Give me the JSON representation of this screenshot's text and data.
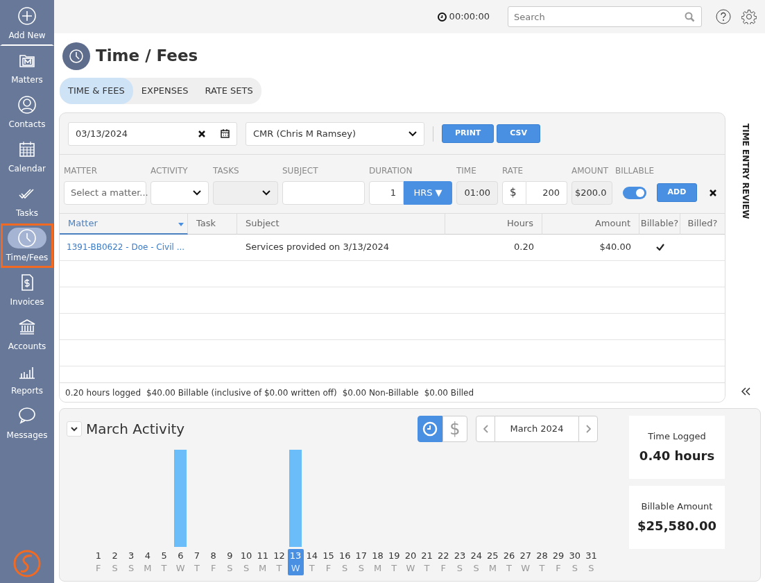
{
  "sidebar": {
    "items": [
      {
        "label": "Add New",
        "kind": "add",
        "selected": false
      },
      {
        "label": "Matters",
        "kind": "matters",
        "selected": false
      },
      {
        "label": "Contacts",
        "kind": "contacts",
        "selected": false
      },
      {
        "label": "Calendar",
        "kind": "calendar",
        "selected": false
      },
      {
        "label": "Tasks",
        "kind": "tasks",
        "selected": false
      },
      {
        "label": "Time/Fees",
        "kind": "time",
        "selected": true
      },
      {
        "label": "Invoices",
        "kind": "invoices",
        "selected": false
      },
      {
        "label": "Accounts",
        "kind": "accounts",
        "selected": false
      },
      {
        "label": "Reports",
        "kind": "reports",
        "selected": false
      },
      {
        "label": "Messages",
        "kind": "messages",
        "selected": false
      }
    ]
  },
  "header": {
    "timer": "00:00:00",
    "search": {
      "placeholder": "Search"
    }
  },
  "page": {
    "title": "Time / Fees"
  },
  "tabs": [
    {
      "label": "TIME & FEES",
      "selected": true
    },
    {
      "label": "EXPENSES",
      "selected": false
    },
    {
      "label": "RATE SETS",
      "selected": false
    }
  ],
  "toolbar": {
    "date": "03/13/2024",
    "user": "CMR (Chris M Ramsey)",
    "buttons": [
      "PRINT",
      "CSV"
    ]
  },
  "entry_form": {
    "matter": {
      "label": "MATTER",
      "placeholder": "Select a matter..."
    },
    "activity": {
      "label": "ACTIVITY",
      "disabled": false
    },
    "tasks": {
      "label": "TASKS",
      "disabled": true
    },
    "subject": {
      "label": "SUBJECT"
    },
    "duration": {
      "label": "DURATION",
      "value": "1",
      "unit": "HRS ▼"
    },
    "time": {
      "label": "TIME",
      "value": "01:00"
    },
    "rate": {
      "label": "RATE",
      "prefix": "$",
      "value": "200"
    },
    "amount": {
      "label": "AMOUNT",
      "value": "$200.0"
    },
    "billable": {
      "label": "BILLABLE",
      "on": true
    },
    "add_button": "ADD"
  },
  "table": {
    "columns": [
      {
        "label": "Matter",
        "sorted": true
      },
      {
        "label": "Task",
        "sorted": false
      },
      {
        "label": "Subject",
        "sorted": false
      },
      {
        "label": "Hours",
        "sorted": false
      },
      {
        "label": "Amount",
        "sorted": false
      },
      {
        "label": "Billable?",
        "sorted": false
      },
      {
        "label": "Billed?",
        "sorted": false
      }
    ],
    "rows": [
      {
        "matter": "1391-BB0622 - Doe - Civil ...",
        "subject": "Services provided on 3/13/2024",
        "hours": "0.20",
        "amount": "$40.00",
        "billable": true
      }
    ]
  },
  "summary": [
    "0.20 hours logged",
    "$40.00 Billable (inclusive of $0.00 written off)",
    "$0.00 Non-Billable",
    "$0.00 Billed"
  ],
  "side_panel": {
    "title": "TIME ENTRY REVIEW"
  },
  "activity": {
    "title": "March Activity",
    "modes": [
      {
        "kind": "time",
        "selected": true
      },
      {
        "kind": "money",
        "label": "$",
        "selected": false
      }
    ],
    "month": "March 2024",
    "days": [
      {
        "day": "1",
        "weekday": "F",
        "has_bar": false,
        "selected": false
      },
      {
        "day": "2",
        "weekday": "S",
        "has_bar": false,
        "selected": false
      },
      {
        "day": "3",
        "weekday": "S",
        "has_bar": false,
        "selected": false
      },
      {
        "day": "4",
        "weekday": "M",
        "has_bar": false,
        "selected": false
      },
      {
        "day": "5",
        "weekday": "T",
        "has_bar": false,
        "selected": false
      },
      {
        "day": "6",
        "weekday": "W",
        "has_bar": true,
        "selected": false
      },
      {
        "day": "7",
        "weekday": "T",
        "has_bar": false,
        "selected": false
      },
      {
        "day": "8",
        "weekday": "F",
        "has_bar": false,
        "selected": false
      },
      {
        "day": "9",
        "weekday": "S",
        "has_bar": false,
        "selected": false
      },
      {
        "day": "10",
        "weekday": "S",
        "has_bar": false,
        "selected": false
      },
      {
        "day": "11",
        "weekday": "M",
        "has_bar": false,
        "selected": false
      },
      {
        "day": "12",
        "weekday": "T",
        "has_bar": false,
        "selected": false
      },
      {
        "day": "13",
        "weekday": "W",
        "has_bar": true,
        "selected": true
      },
      {
        "day": "14",
        "weekday": "T",
        "has_bar": false,
        "selected": false
      },
      {
        "day": "15",
        "weekday": "F",
        "has_bar": false,
        "selected": false
      },
      {
        "day": "16",
        "weekday": "S",
        "has_bar": false,
        "selected": false
      },
      {
        "day": "17",
        "weekday": "S",
        "has_bar": false,
        "selected": false
      },
      {
        "day": "18",
        "weekday": "M",
        "has_bar": false,
        "selected": false
      },
      {
        "day": "19",
        "weekday": "T",
        "has_bar": false,
        "selected": false
      },
      {
        "day": "20",
        "weekday": "W",
        "has_bar": false,
        "selected": false
      },
      {
        "day": "21",
        "weekday": "T",
        "has_bar": false,
        "selected": false
      },
      {
        "day": "22",
        "weekday": "F",
        "has_bar": false,
        "selected": false
      },
      {
        "day": "23",
        "weekday": "S",
        "has_bar": false,
        "selected": false
      },
      {
        "day": "24",
        "weekday": "S",
        "has_bar": false,
        "selected": false
      },
      {
        "day": "25",
        "weekday": "M",
        "has_bar": false,
        "selected": false
      },
      {
        "day": "26",
        "weekday": "T",
        "has_bar": false,
        "selected": false
      },
      {
        "day": "27",
        "weekday": "W",
        "has_bar": false,
        "selected": false
      },
      {
        "day": "28",
        "weekday": "T",
        "has_bar": false,
        "selected": false
      },
      {
        "day": "29",
        "weekday": "F",
        "has_bar": false,
        "selected": false
      },
      {
        "day": "30",
        "weekday": "S",
        "has_bar": false,
        "selected": false
      },
      {
        "day": "31",
        "weekday": "S",
        "has_bar": false,
        "selected": false
      }
    ],
    "stats": [
      {
        "label": "Time Logged",
        "value": "0.40 hours"
      },
      {
        "label": "Billable Amount",
        "value": "$25,580.00"
      }
    ]
  }
}
